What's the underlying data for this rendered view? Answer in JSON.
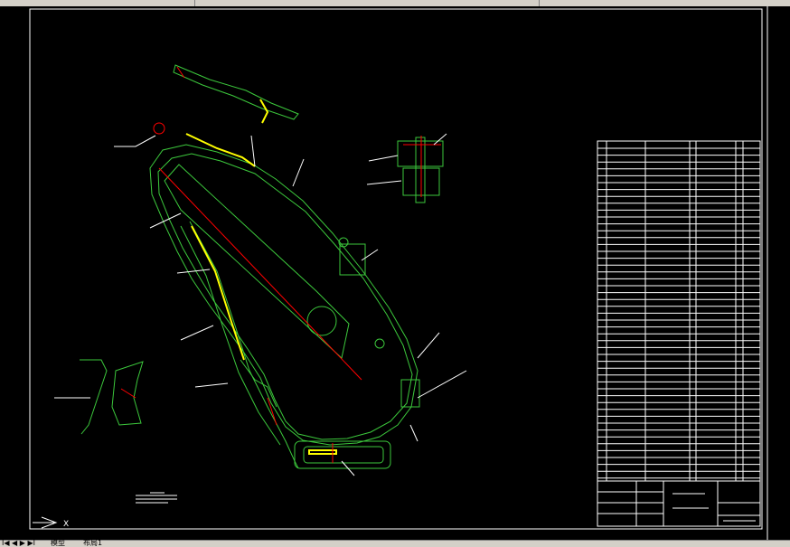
{
  "status": {
    "tab_model": "模型",
    "tab_layout": "布局1",
    "nav_arrows": "I◀ ◀ ▶ ▶I"
  },
  "colors": {
    "background": "#000000",
    "frame": "#ffffff",
    "outline_green": "#3cc83c",
    "highlight_yellow": "#ffff00",
    "centerline_red": "#ff0000",
    "table_lines": "#ffffff"
  },
  "drawing": {
    "ucs_icon": "ucs-axis-icon",
    "axis_label": "X"
  }
}
